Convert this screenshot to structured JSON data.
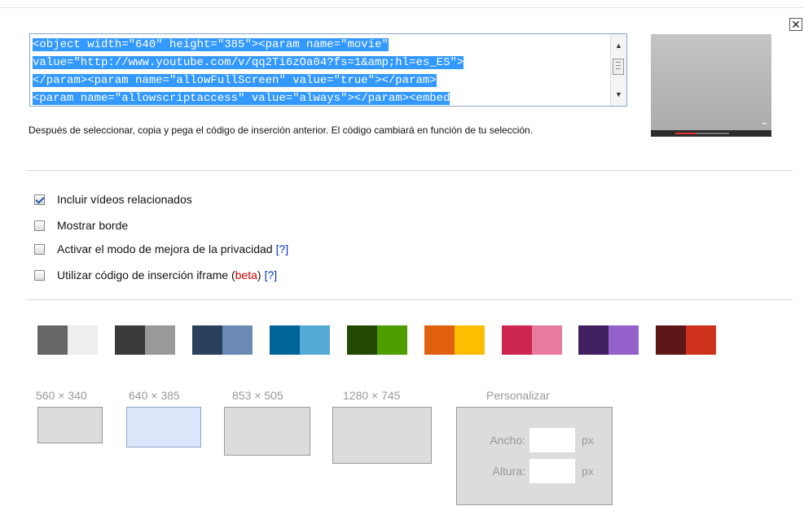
{
  "close": {
    "label": "✕"
  },
  "embed_code": {
    "lines": [
      "<object width=\"640\" height=\"385\"><param name=\"movie\"",
      "value=\"http://www.youtube.com/v/qq2Ti6zOa04?fs=1&amp;hl=es_ES\">",
      "</param><param name=\"allowFullScreen\" value=\"true\"></param>",
      "<param name=\"allowscriptaccess\" value=\"always\"></param><embed"
    ]
  },
  "hint_text": "Después de seleccionar, copia y pega el código de inserción anterior. El código cambiará en función de tu selección.",
  "options": [
    {
      "label": "Incluir vídeos relacionados",
      "checked": true
    },
    {
      "label": "Mostrar borde",
      "checked": false
    },
    {
      "label": "Activar el modo de mejora de la privacidad",
      "help": "[?]",
      "checked": false
    },
    {
      "label": "Utilizar código de inserción iframe (",
      "beta": "beta",
      "after_beta": ")",
      "help": "[?]",
      "checked": false
    }
  ],
  "color_themes": [
    {
      "left": "#666666",
      "right": "#eeeeee"
    },
    {
      "left": "#3a3a3a",
      "right": "#999999"
    },
    {
      "left": "#2b405b",
      "right": "#6b8ab6"
    },
    {
      "left": "#006699",
      "right": "#54abd6"
    },
    {
      "left": "#234900",
      "right": "#4e9e00"
    },
    {
      "left": "#e1600f",
      "right": "#febd01"
    },
    {
      "left": "#cc2550",
      "right": "#e87a9f"
    },
    {
      "left": "#402061",
      "right": "#9461ca"
    },
    {
      "left": "#5d1719",
      "right": "#cd311b"
    }
  ],
  "sizes": [
    {
      "label": "560 × 340",
      "selected": false
    },
    {
      "label": "640 × 385",
      "selected": true
    },
    {
      "label": "853 × 505",
      "selected": false
    },
    {
      "label": "1280 × 745",
      "selected": false
    }
  ],
  "custom": {
    "title": "Personalizar",
    "width_label": "Ancho:",
    "height_label": "Altura:",
    "unit": "px"
  }
}
